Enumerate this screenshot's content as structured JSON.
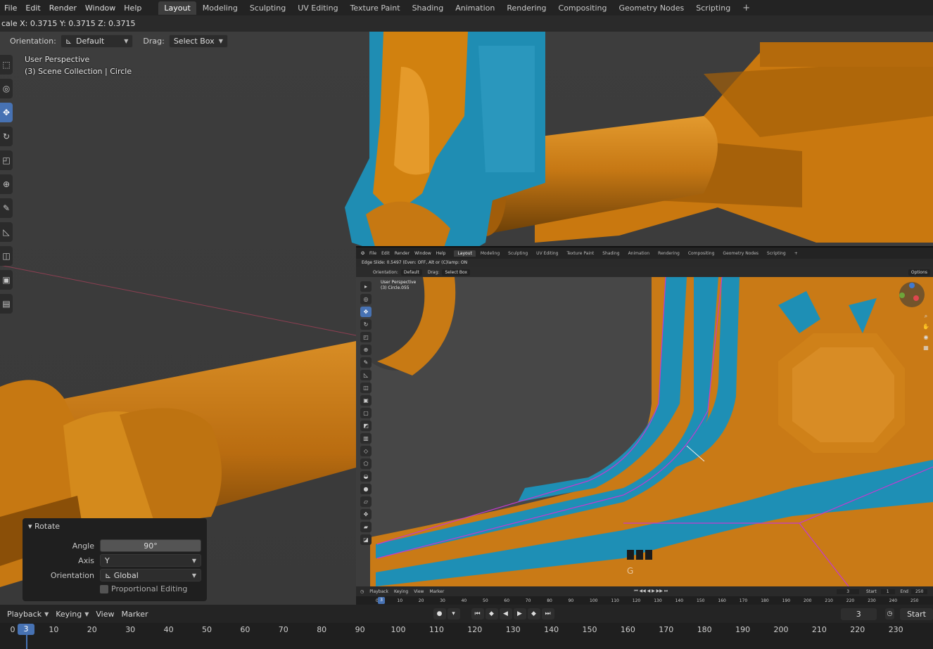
{
  "menu": [
    "File",
    "Edit",
    "Render",
    "Window",
    "Help"
  ],
  "workspaces": [
    {
      "label": "Layout",
      "active": true
    },
    {
      "label": "Modeling",
      "active": false
    },
    {
      "label": "Sculpting",
      "active": false
    },
    {
      "label": "UV Editing",
      "active": false
    },
    {
      "label": "Texture Paint",
      "active": false
    },
    {
      "label": "Shading",
      "active": false
    },
    {
      "label": "Animation",
      "active": false
    },
    {
      "label": "Rendering",
      "active": false
    },
    {
      "label": "Compositing",
      "active": false
    },
    {
      "label": "Geometry Nodes",
      "active": false
    },
    {
      "label": "Scripting",
      "active": false
    }
  ],
  "add_workspace": "+",
  "status": "cale X: 0.3715   Y: 0.3715   Z: 0.3715",
  "header": {
    "orientation_label": "Orientation:",
    "orientation_value": "Default",
    "drag_label": "Drag:",
    "drag_value": "Select Box"
  },
  "viewport": {
    "perspective": "User Perspective",
    "collection": "(3) Scene Collection | Circle"
  },
  "colors": {
    "accent": "#4772b3",
    "orange": "#c97a16",
    "blue": "#1e8fb5",
    "edge": "#c43ad0"
  },
  "rotate_panel": {
    "title": "Rotate",
    "angle_label": "Angle",
    "angle_value": "90°",
    "axis_label": "Axis",
    "axis_value": "Y",
    "orientation_label": "Orientation",
    "orientation_value": "Global",
    "proportional_label": "Proportional Editing"
  },
  "inset": {
    "menu": [
      "File",
      "Edit",
      "Render",
      "Window",
      "Help"
    ],
    "workspaces": [
      "Layout",
      "Modeling",
      "Sculpting",
      "UV Editing",
      "Texture Paint",
      "Shading",
      "Animation",
      "Rendering",
      "Compositing",
      "Geometry Nodes",
      "Scripting"
    ],
    "status": "Edge Slide: 0.5497 (Even: OFF, Alt or (C)lamp: ON",
    "orientation_label": "Orientation:",
    "orientation_value": "Default",
    "drag_label": "Drag:",
    "drag_value": "Select Box",
    "options": "Options",
    "perspective": "User Perspective",
    "collection": "(3) Circle.055",
    "key_hint": "G",
    "timeline_menu": [
      "Playback",
      "Keying",
      "View",
      "Marker"
    ],
    "current_frame": "3",
    "start_label": "Start",
    "start_value": "1",
    "end_label": "End",
    "end_value": "250",
    "frame_box": "3",
    "start_button": "Start",
    "ticks": [
      "0",
      "10",
      "20",
      "30",
      "40",
      "50",
      "60",
      "70",
      "80",
      "90",
      "100",
      "110",
      "120",
      "130",
      "140",
      "150",
      "160",
      "170",
      "180",
      "190",
      "200",
      "210",
      "220",
      "230",
      "240",
      "250"
    ]
  },
  "timeline": {
    "menu": [
      "Playback",
      "Keying",
      "View",
      "Marker"
    ],
    "current_frame": "3",
    "frame_field": "3",
    "start_label": "Start",
    "ticks": [
      "0",
      "10",
      "20",
      "30",
      "40",
      "50",
      "60",
      "70",
      "80",
      "90",
      "100",
      "110",
      "120",
      "130",
      "140",
      "150",
      "160",
      "170",
      "180",
      "190",
      "200",
      "210",
      "220",
      "230"
    ]
  }
}
